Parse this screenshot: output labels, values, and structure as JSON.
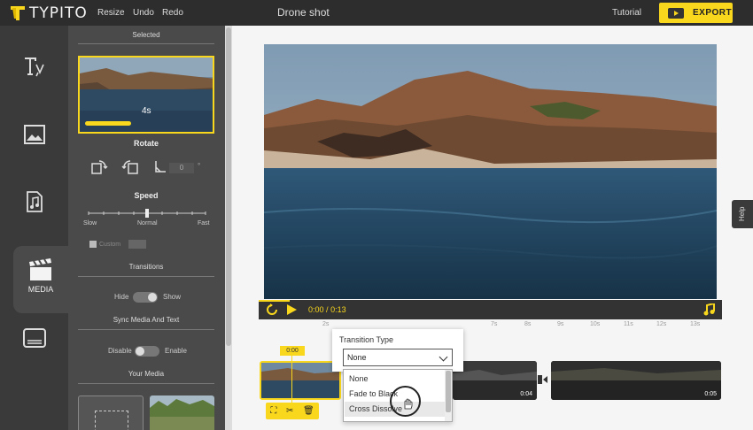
{
  "app": {
    "logo_text": "TYPITO",
    "project_title": "Drone shot"
  },
  "topnav": {
    "resize": "Resize",
    "undo": "Undo",
    "redo": "Redo",
    "tutorial": "Tutorial",
    "export": "EXPORT"
  },
  "rail": {
    "media_label": "MEDIA"
  },
  "panel": {
    "selected_title": "Selected",
    "selected_duration": "4s",
    "rotate_title": "Rotate",
    "angle_value": "0",
    "angle_unit": "°",
    "speed_title": "Speed",
    "speed_slow": "Slow",
    "speed_normal": "Normal",
    "speed_fast": "Fast",
    "custom_label": "Custom",
    "transitions_title": "Transitions",
    "hide_label": "Hide",
    "show_label": "Show",
    "sync_title": "Sync Media And Text",
    "disable_label": "Disable",
    "enable_label": "Enable",
    "your_media_title": "Your Media"
  },
  "player": {
    "current_time": "0:00",
    "separator": "/",
    "total_time": "0:13"
  },
  "help_label": "Help",
  "timeline": {
    "playhead_time": "0:00",
    "ruler": [
      "2s",
      "7s",
      "8s",
      "9s",
      "10s",
      "11s",
      "12s",
      "13s"
    ],
    "clips": [
      {
        "duration": ""
      },
      {
        "duration": "0:04"
      },
      {
        "duration": "0:05"
      }
    ]
  },
  "transition_dropdown": {
    "label": "Transition Type",
    "selected": "None",
    "options": [
      "None",
      "Fade to Black",
      "Cross Dissolve"
    ]
  },
  "colors": {
    "accent": "#f9d71c",
    "dark": "#3a3a3a"
  }
}
